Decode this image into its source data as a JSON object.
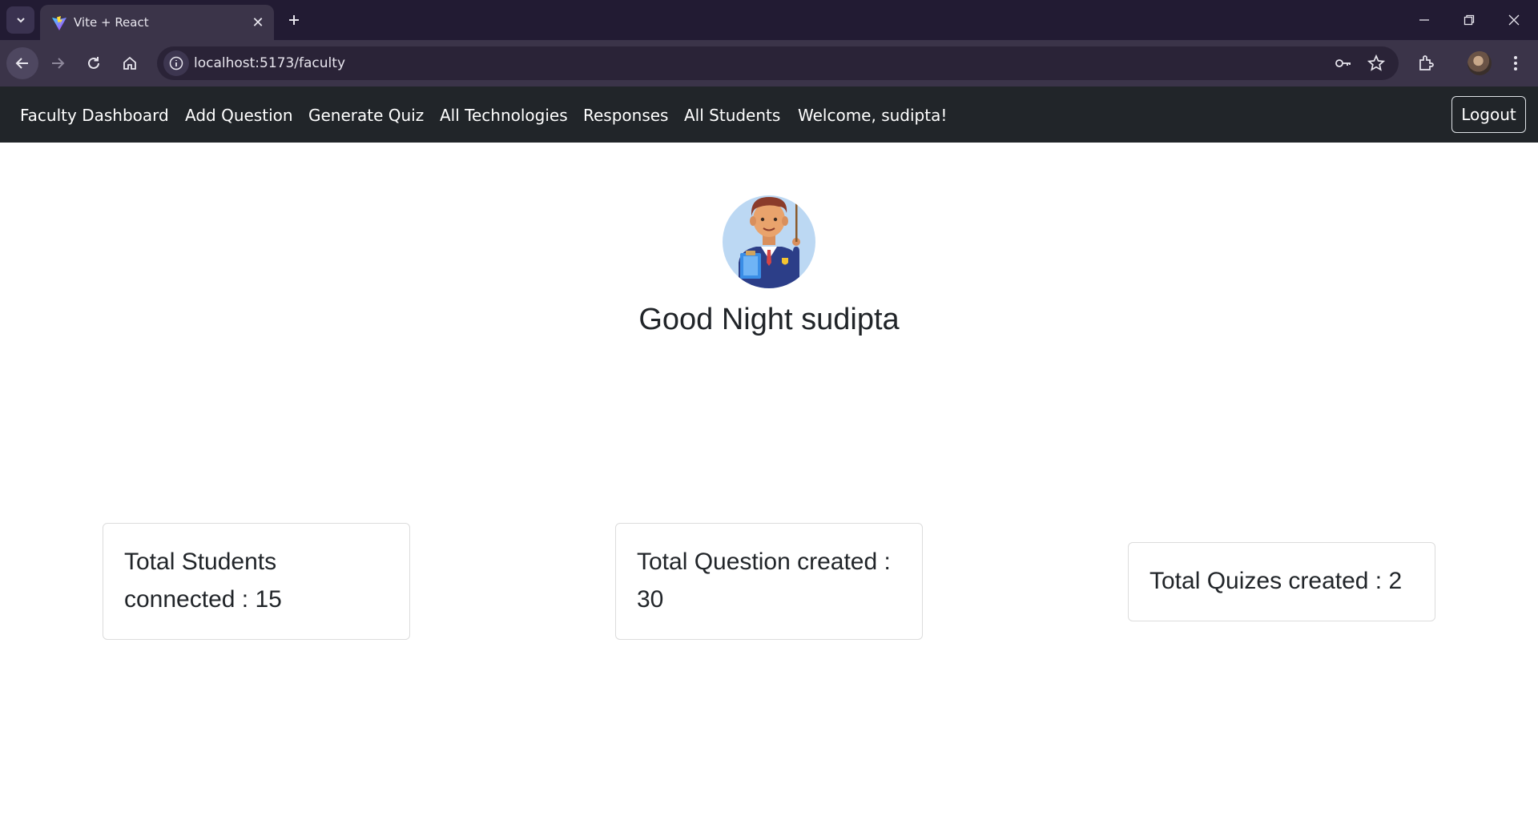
{
  "browser": {
    "tab": {
      "title": "Vite + React",
      "favicon": "vite-logo-icon"
    },
    "url": "localhost:5173/faculty"
  },
  "navbar": {
    "brand": "Faculty Dashboard",
    "links": [
      "Add Question",
      "Generate Quiz",
      "All Technologies",
      "Responses",
      "All Students"
    ],
    "welcome": "Welcome, sudipta!",
    "logout": "Logout"
  },
  "main": {
    "avatar_icon": "teacher-illustration-icon",
    "greeting": "Good Night sudipta"
  },
  "stats": [
    {
      "line1": "Total Students",
      "line2": "connected : 15"
    },
    {
      "line1": "Total Question created :",
      "line2": "30"
    },
    {
      "line1": "Total Quizes created : 2",
      "line2": ""
    }
  ],
  "colors": {
    "navbar_bg": "#212529",
    "chrome_bg": "#221b33",
    "toolbar_bg": "#3b3449"
  }
}
